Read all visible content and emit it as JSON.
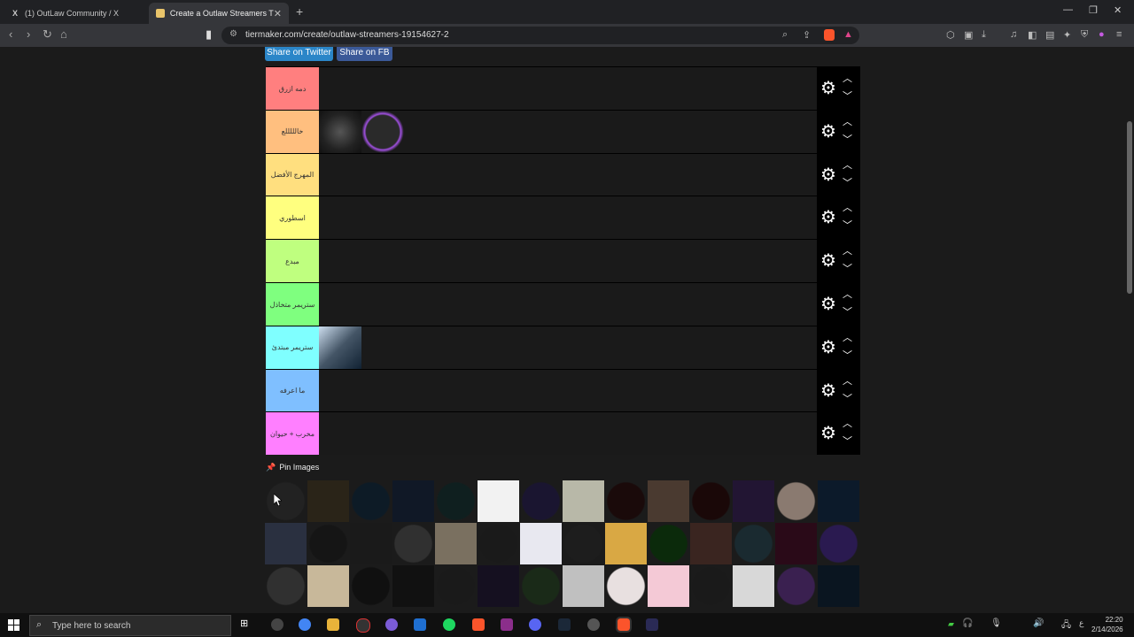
{
  "browser": {
    "tabs": [
      {
        "label": "(1) OutLaw Community / X",
        "favicon": "X"
      },
      {
        "label": "Create a Outlaw Streamers Tier L"
      }
    ],
    "url": "tiermaker.com/create/outlaw-streamers-19154627-2"
  },
  "share": {
    "twitter": "Share on Twitter",
    "facebook": "Share on FB"
  },
  "tiers": [
    {
      "label": "دمه ازرق",
      "color": "#ff7f7f"
    },
    {
      "label": "خالللللع",
      "color": "#ffbf7f"
    },
    {
      "label": "المهرج الأفضل",
      "color": "#ffdf7f"
    },
    {
      "label": "اسطوري",
      "color": "#ffff7f"
    },
    {
      "label": "مبدع",
      "color": "#bfff7f"
    },
    {
      "label": "ستريمر متخاذل",
      "color": "#7fff7f"
    },
    {
      "label": "ستريمر مبتدئ",
      "color": "#7fffff"
    },
    {
      "label": "ما اعرفه",
      "color": "#7fbfff"
    },
    {
      "label": "مخرب + حيوان",
      "color": "#ff7fff"
    }
  ],
  "pin_images": {
    "label": "Pin Images"
  },
  "taskbar": {
    "search_placeholder": "Type here to search",
    "time": "22:20",
    "date": "2/14/2026",
    "lang": "ع"
  }
}
